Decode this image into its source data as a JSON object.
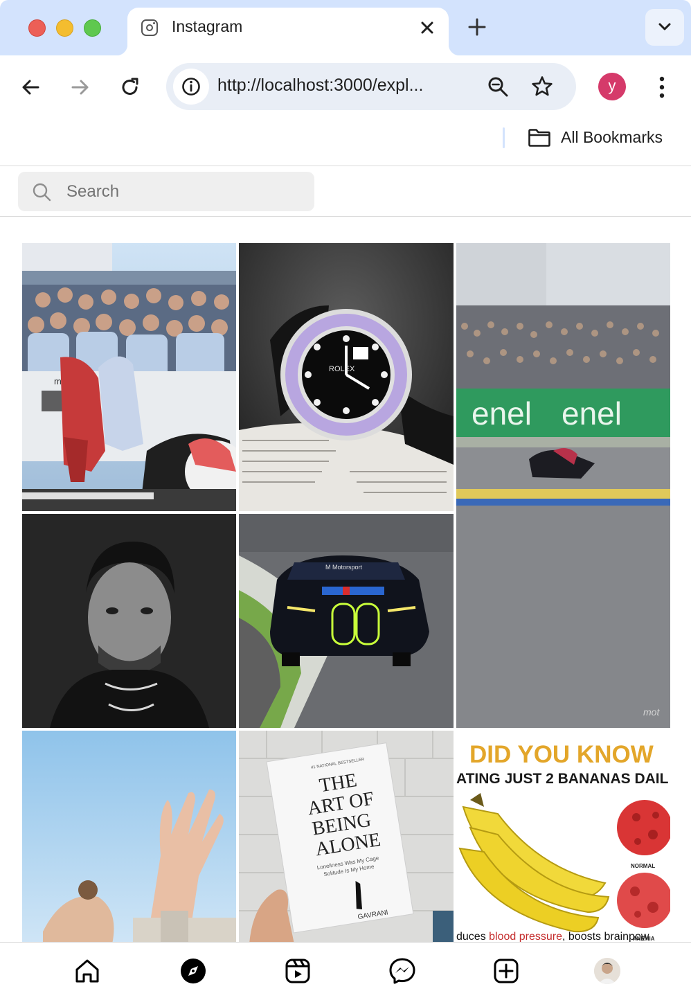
{
  "browser": {
    "tab_title": "Instagram",
    "url": "http://localhost:3000/expl...",
    "profile_initial": "y",
    "bookmarks_label": "All Bookmarks",
    "colors": {
      "tabstrip": "#d3e3fd",
      "profile": "#d53a6a"
    }
  },
  "page": {
    "search": {
      "placeholder": "Search",
      "value": ""
    },
    "grid": [
      {
        "name": "motogp-team-celebration",
        "texts": [
          "motog"
        ]
      },
      {
        "name": "rolex-watch-on-book",
        "texts": [
          "ROLEX"
        ]
      },
      {
        "name": "motogp-enel-track-video",
        "texts": [
          "enel",
          "enel"
        ]
      },
      {
        "name": "portrait-black-and-white",
        "texts": []
      },
      {
        "name": "bmw-m4-race-car",
        "texts": [
          "M Motorsport"
        ]
      },
      {
        "name": "hand-sky-photo",
        "texts": []
      },
      {
        "name": "art-of-being-alone-book",
        "texts": [
          "#1 NATIONAL BESTSELLER",
          "THE",
          "ART OF",
          "BEING",
          "ALONE",
          "Loneliness Was My Cage",
          "Solitude Is My Home",
          "GAVRANI"
        ]
      },
      {
        "name": "bananas-did-you-know",
        "texts": [
          "DID YOU KNOW",
          "ATING JUST 2 BANANAS DAIL",
          "NORMAL",
          "ANEMIA",
          "duces",
          "blood pressure",
          ", boosts brainpow"
        ]
      }
    ],
    "bottom_nav": {
      "items": [
        "home-icon",
        "explore-icon",
        "reels-icon",
        "messenger-icon",
        "create-icon",
        "profile-avatar"
      ]
    }
  }
}
